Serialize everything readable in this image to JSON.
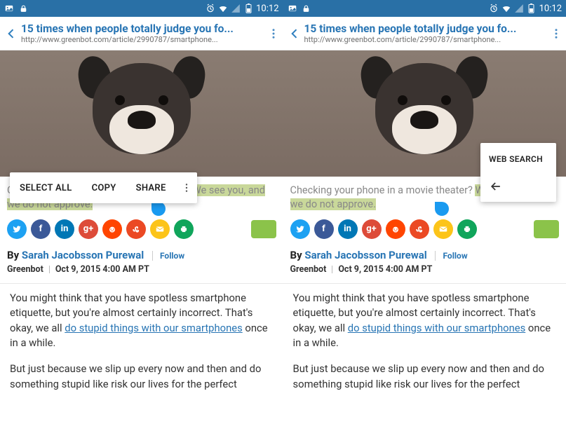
{
  "status": {
    "time": "10:12"
  },
  "browser": {
    "title": "15 times when people totally judge you fo...",
    "url": "http://www.greenbot.com/article/2990787/smartphone..."
  },
  "caption": {
    "before": "Checking your phone in a movie theater? ",
    "highlighted": "We see you, and we do not approve.",
    "after": ""
  },
  "selection_menu": {
    "select_all": "SELECT ALL",
    "copy": "COPY",
    "share": "SHARE"
  },
  "websearch_menu": {
    "label": "WEB SEARCH"
  },
  "byline": {
    "by": "By ",
    "author": "Sarah Jacobsson Purewal",
    "follow": "Follow"
  },
  "meta": {
    "source": "Greenbot",
    "date": "Oct 9, 2015 4:00 AM PT"
  },
  "article": {
    "p1a": "You might think that you have spotless smartphone etiquette, but you're almost certainly incorrect. That's okay, we all ",
    "p1_link": "do stupid things with our smartphones",
    "p1b": " once in a while.",
    "p2": "But just because we slip up every now and then and do something stupid like risk our lives for the perfect"
  }
}
